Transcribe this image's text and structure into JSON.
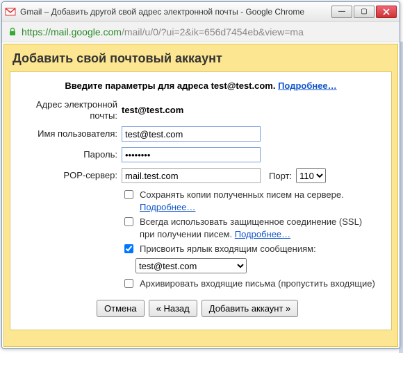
{
  "window": {
    "title": "Gmail – Добавить другой свой адрес электронной почты - Google Chrome",
    "url_host": "https://mail.google.com",
    "url_path": "/mail/u/0/?ui=2&ik=656d7454eb&view=ma"
  },
  "header": "Добавить свой почтовый аккаунт",
  "instruction_prefix": "Введите параметры для адреса test@test.com. ",
  "learn_more": "Подробнее…",
  "labels": {
    "email": "Адрес электронной почты:",
    "username": "Имя пользователя:",
    "password": "Пароль:",
    "pop": "POP-сервер:",
    "port": "Порт:"
  },
  "values": {
    "email_static": "test@test.com",
    "username": "test@test.com",
    "password": "••••••••",
    "pop": "mail.test.com",
    "port_selected": "110"
  },
  "checks": {
    "keep_copy": "Сохранять копии полученных писем на сервере. ",
    "ssl": "Всегда использовать защищенное соединение (SSL) при получении писем. ",
    "label": "Присвоить ярлык входящим сообщениям:",
    "label_selected": "test@test.com",
    "archive": "Архивировать входящие письма (пропустить входящие)"
  },
  "buttons": {
    "cancel": "Отмена",
    "back": "« Назад",
    "add": "Добавить аккаунт »"
  }
}
